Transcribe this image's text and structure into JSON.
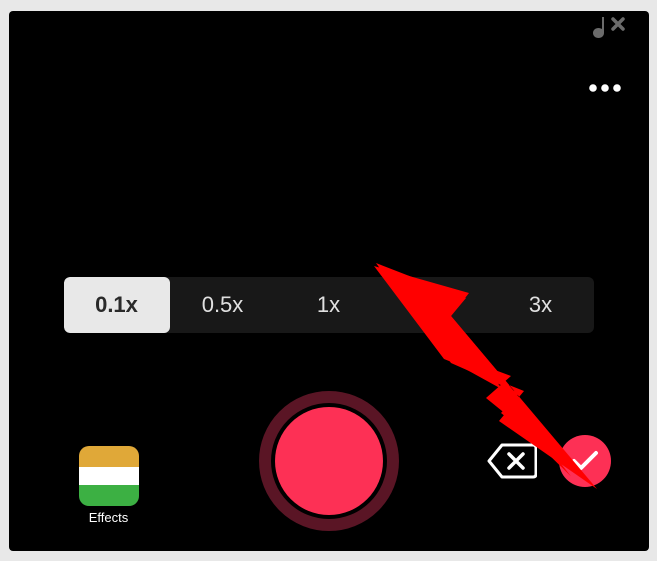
{
  "speeds": {
    "options": [
      "0.1x",
      "0.5x",
      "1x",
      "",
      "3x"
    ],
    "selected_index": 0
  },
  "effects": {
    "label": "Effects"
  },
  "icons": {
    "music_cut": "music-note-cut",
    "more": "more-horizontal",
    "delete": "backspace-x",
    "confirm": "check"
  },
  "colors": {
    "accent": "#fd3055",
    "record_ring": "#5a1525"
  }
}
